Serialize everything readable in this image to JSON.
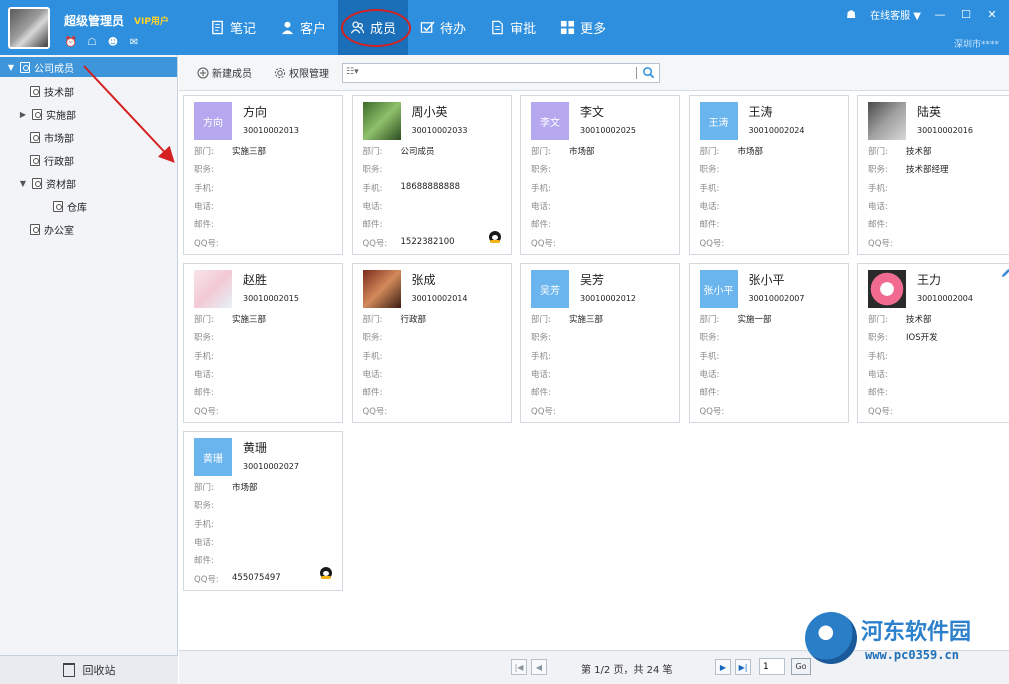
{
  "user": {
    "name": "超级管理员",
    "vip": "VIP用户"
  },
  "nav": [
    {
      "label": "笔记",
      "icon": "notebook-icon"
    },
    {
      "label": "客户",
      "icon": "customer-icon"
    },
    {
      "label": "成员",
      "icon": "members-icon"
    },
    {
      "label": "待办",
      "icon": "todo-icon"
    },
    {
      "label": "审批",
      "icon": "approval-icon"
    },
    {
      "label": "更多",
      "icon": "more-icon"
    }
  ],
  "window": {
    "service": "在线客服 ▼",
    "city": "深圳市****"
  },
  "tree": [
    "公司成员",
    "技术部",
    "实施部",
    "市场部",
    "行政部",
    "资材部",
    "仓库",
    "办公室"
  ],
  "recycle": "回收站",
  "toolbar": {
    "new_member": "新建成员",
    "permissions": "权限管理",
    "search_placeholder": ""
  },
  "fields": [
    "部门:",
    "职务:",
    "手机:",
    "电话:",
    "邮件:",
    "QQ号:"
  ],
  "members": [
    {
      "name": "方向",
      "id": "30010002013",
      "photo_text": "方向",
      "dept": "实施三部",
      "title": "",
      "mobile": "",
      "phone": "",
      "email": "",
      "qq": ""
    },
    {
      "name": "周小英",
      "id": "30010002033",
      "photo_text": "",
      "dept": "公司成员",
      "title": "",
      "mobile": "18688888888",
      "phone": "",
      "email": "",
      "qq": "1522382100"
    },
    {
      "name": "李文",
      "id": "30010002025",
      "photo_text": "李文",
      "dept": "市场部",
      "title": "",
      "mobile": "",
      "phone": "",
      "email": "",
      "qq": ""
    },
    {
      "name": "王涛",
      "id": "30010002024",
      "photo_text": "王涛",
      "dept": "市场部",
      "title": "",
      "mobile": "",
      "phone": "",
      "email": "",
      "qq": ""
    },
    {
      "name": "陆英",
      "id": "30010002016",
      "photo_text": "",
      "dept": "技术部",
      "title": "技术部经理",
      "mobile": "",
      "phone": "",
      "email": "",
      "qq": ""
    },
    {
      "name": "赵胜",
      "id": "30010002015",
      "photo_text": "",
      "dept": "实施三部",
      "title": "",
      "mobile": "",
      "phone": "",
      "email": "",
      "qq": ""
    },
    {
      "name": "张成",
      "id": "30010002014",
      "photo_text": "",
      "dept": "行政部",
      "title": "",
      "mobile": "",
      "phone": "",
      "email": "",
      "qq": ""
    },
    {
      "name": "吴芳",
      "id": "30010002012",
      "photo_text": "吴芳",
      "dept": "实施三部",
      "title": "",
      "mobile": "",
      "phone": "",
      "email": "",
      "qq": ""
    },
    {
      "name": "张小平",
      "id": "30010002007",
      "photo_text": "张小平",
      "dept": "实施一部",
      "title": "",
      "mobile": "",
      "phone": "",
      "email": "",
      "qq": ""
    },
    {
      "name": "王力",
      "id": "30010002004",
      "photo_text": "",
      "dept": "技术部",
      "title": "IOS开发",
      "mobile": "",
      "phone": "",
      "email": "",
      "qq": ""
    },
    {
      "name": "黄珊",
      "id": "30010002027",
      "photo_text": "黄珊",
      "dept": "市场部",
      "title": "",
      "mobile": "",
      "phone": "",
      "email": "",
      "qq": "455075497"
    }
  ],
  "pager": {
    "info": "第 1/2 页，共 24 笔",
    "page": "1",
    "go": "Go"
  },
  "watermark": {
    "title": "河东软件园",
    "url": "www.pc0359.cn"
  },
  "colors": {
    "accent": "#2d8fdd",
    "active_tab": "#1b6fb8",
    "avatar_blue": "#6bb5ee",
    "avatar_purple": "#b5a8ef",
    "annotation": "#d42020"
  }
}
